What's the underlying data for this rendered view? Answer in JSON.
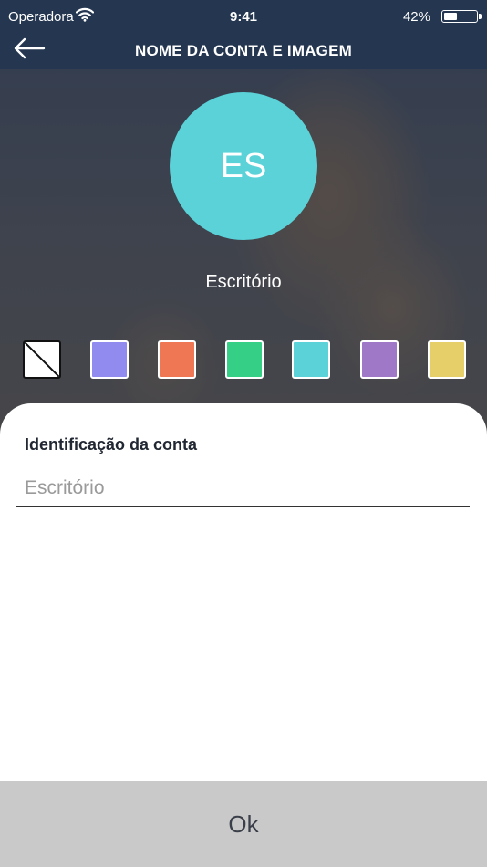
{
  "status_bar": {
    "carrier": "Operadora",
    "time": "9:41",
    "battery_percent": "42%",
    "battery_level": 0.42,
    "wifi_icon": "wifi-icon"
  },
  "header": {
    "title": "NOME DA CONTA E IMAGEM",
    "back_icon": "arrow-left-icon"
  },
  "avatar": {
    "initials": "ES",
    "color": "#5ad2d8"
  },
  "account_name": "Escritório",
  "swatches": [
    {
      "name": "none",
      "color": "#ffffff"
    },
    {
      "name": "lavender",
      "color": "#918bf0"
    },
    {
      "name": "orange",
      "color": "#ef7753"
    },
    {
      "name": "green",
      "color": "#35d086"
    },
    {
      "name": "cyan",
      "color": "#5ad2d8"
    },
    {
      "name": "purple",
      "color": "#a078c8"
    },
    {
      "name": "yellow",
      "color": "#e6cf68"
    }
  ],
  "form": {
    "label": "Identificação da conta",
    "placeholder": "Escritório"
  },
  "ok_button": {
    "label": "Ok"
  },
  "colors": {
    "header_bg": "#243650",
    "ok_button_bg": "#c9c9c9"
  }
}
